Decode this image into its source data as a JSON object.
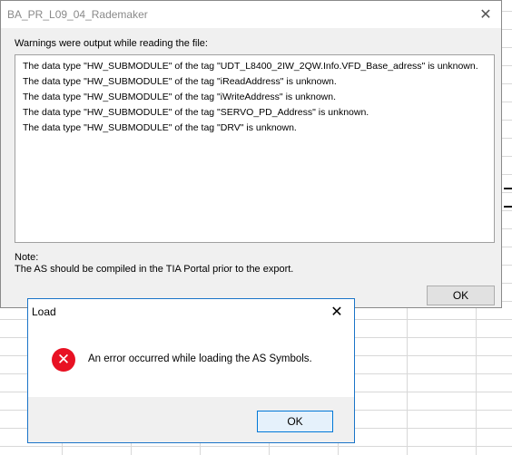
{
  "warnings_window": {
    "title": "BA_PR_L09_04_Rademaker",
    "close_glyph": "✕",
    "intro": "Warnings were output while reading the file:",
    "warnings": [
      "The data type \"HW_SUBMODULE\" of the tag \"UDT_L8400_2IW_2QW.Info.VFD_Base_adress\" is unknown.",
      "The data type \"HW_SUBMODULE\" of the tag \"iReadAddress\" is unknown.",
      "The data type \"HW_SUBMODULE\" of the tag \"iWriteAddress\" is unknown.",
      "The data type \"HW_SUBMODULE\" of the tag \"SERVO_PD_Address\" is unknown.",
      "The data type \"HW_SUBMODULE\" of the tag \"DRV\" is unknown."
    ],
    "note_label": "Note:",
    "note_text": "The AS should be compiled in the TIA Portal prior to the export.",
    "ok_label": "OK"
  },
  "load_dialog": {
    "title": "Load",
    "close_glyph": "✕",
    "icon": "error-icon",
    "icon_glyph": "✕",
    "message": "An error occurred while loading the AS Symbols.",
    "ok_label": "OK"
  }
}
